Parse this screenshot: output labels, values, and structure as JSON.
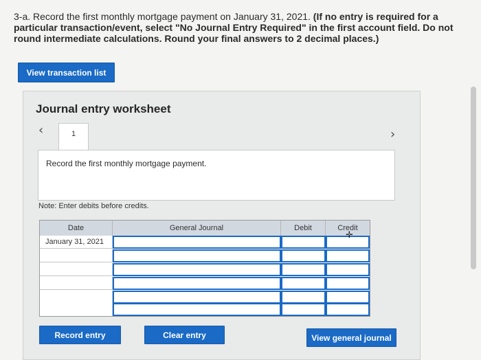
{
  "instructions": {
    "prefix": "3-a. Record the first monthly mortgage payment on January 31, 2021. ",
    "bold": "(If no entry is required for a particular transaction/event, select \"No Journal Entry Required\" in the first account field. Do not round intermediate calculations. Round your final answers to 2 decimal places.)"
  },
  "view_transaction_label": "View transaction list",
  "worksheet": {
    "title": "Journal entry worksheet",
    "tab_number": "1",
    "description": "Record the first monthly mortgage payment.",
    "note": "Note: Enter debits before credits."
  },
  "journal": {
    "headers": {
      "date": "Date",
      "general_journal": "General Journal",
      "debit": "Debit",
      "credit": "Credit"
    },
    "rows": [
      {
        "date": "January 31, 2021"
      },
      {
        "date": ""
      },
      {
        "date": ""
      },
      {
        "date": ""
      },
      {
        "date": ""
      },
      {
        "date": ""
      }
    ]
  },
  "buttons": {
    "record_entry": "Record entry",
    "clear_entry": "Clear entry",
    "view_general_journal": "View general journal"
  },
  "icons": {
    "prev": "chevron-left-icon",
    "next": "chevron-right-icon",
    "cursor": "move-cursor-icon"
  },
  "colors": {
    "accent": "#1a6ac6",
    "header_bg": "#d2d8e0"
  }
}
